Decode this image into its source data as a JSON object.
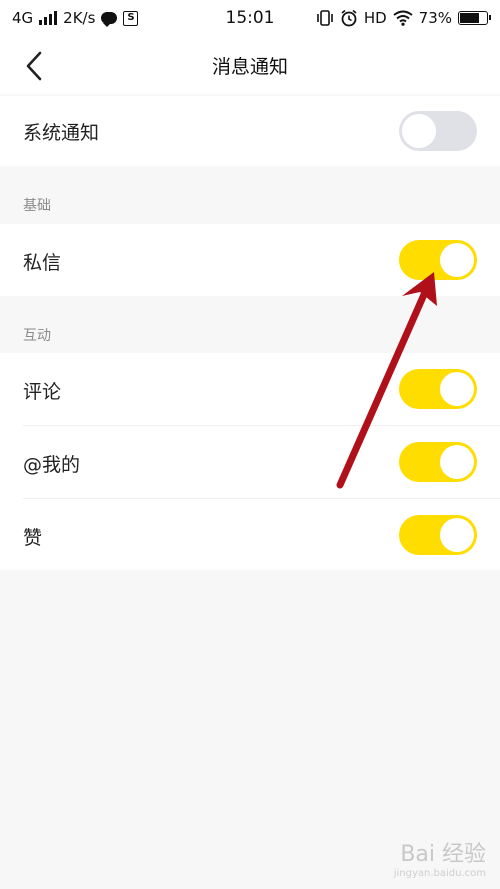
{
  "status_bar": {
    "network": "4G",
    "speed": "2K/s",
    "time": "15:01",
    "hd": "HD",
    "battery": "73%",
    "sim_box": "S"
  },
  "nav": {
    "title": "消息通知"
  },
  "system_notification": {
    "label": "系统通知",
    "enabled": false
  },
  "sections": [
    {
      "header": "基础",
      "items": [
        {
          "label": "私信",
          "enabled": true
        }
      ]
    },
    {
      "header": "互动",
      "items": [
        {
          "label": "评论",
          "enabled": true
        },
        {
          "label": "@我的",
          "enabled": true
        },
        {
          "label": "赞",
          "enabled": true
        }
      ]
    }
  ],
  "watermark": {
    "main": "Bai 经验",
    "sub": "jingyan.baidu.com"
  },
  "colors": {
    "toggle_on": "#ffdd00",
    "toggle_off": "#dfe1e6",
    "annotation_arrow": "#b0101a",
    "background": "#f7f7f7"
  }
}
